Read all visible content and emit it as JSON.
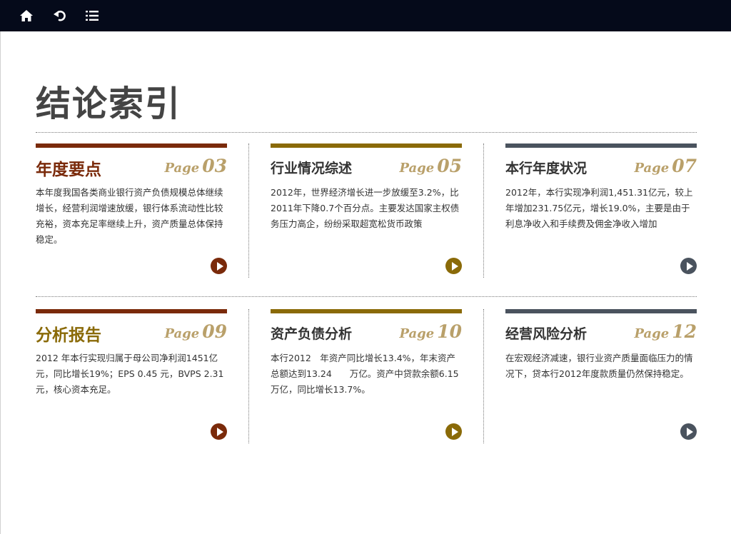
{
  "toolbar": {
    "home_icon": "home-icon",
    "back_icon": "back-icon",
    "menu_icon": "list-menu-icon"
  },
  "colors": {
    "brown": "#7a2a0a",
    "olive": "#8a6a08",
    "slate": "#4a535e",
    "page_label": "#b9a06a"
  },
  "page_title": "结论索引",
  "cards": [
    {
      "title": "年度要点",
      "page_word": "Page",
      "page_num": "03",
      "desc": "本年度我国各类商业银行资产负债规模总体继续增长，经营利润增速放缓，银行体系流动性比较充裕，资本充足率继续上升，资产质量总体保持稳定。"
    },
    {
      "title": "行业情况综述",
      "page_word": "Page",
      "page_num": "05",
      "desc": "2012年，世界经济增长进一步放缓至3.2%，比2011年下降0.7个百分点。主要发达国家主权债务压力高企，纷纷采取超宽松货币政策"
    },
    {
      "title": "本行年度状况",
      "page_word": "Page",
      "page_num": "07",
      "desc": "2012年，本行实现净利润1,451.31亿元，较上年增加231.75亿元，增长19.0%，主要是由于利息净收入和手续费及佣金净收入增加"
    },
    {
      "title": "分析报告",
      "page_word": "Page",
      "page_num": "09",
      "desc": "2012 年本行实现归属于母公司净利润1451亿元，同比增长19%；EPS 0.45 元，BVPS 2.31元，核心资本充足。"
    },
    {
      "title": "资产负债分析",
      "page_word": "Page",
      "page_num": "10",
      "desc": "本行2012　年资产同比增长13.4%，年末资产总额达到13.24　　万亿。资产中贷款余额6.15 万亿，同比增长13.7%。"
    },
    {
      "title": "经营风险分析",
      "page_word": "Page",
      "page_num": "12",
      "desc": "在宏观经济减速，银行业资产质量面临压力的情况下，贷本行2012年度款质量仍然保持稳定。"
    }
  ]
}
